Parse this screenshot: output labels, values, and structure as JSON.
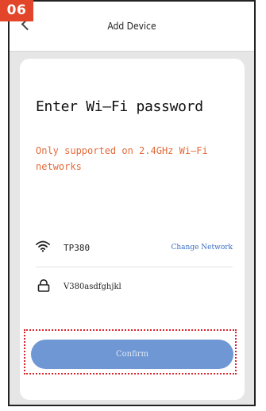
{
  "step_badge": "06",
  "header": {
    "title": "Add Device"
  },
  "card": {
    "heading": "Enter Wi—Fi password",
    "note": "Only supported on 2.4GHz Wi—Fi networks"
  },
  "wifi_row": {
    "icon": "wifi-icon",
    "ssid": "TP380",
    "change_label": "Change Network"
  },
  "password_row": {
    "icon": "lock-icon",
    "value": "V380asdfghjkl"
  },
  "confirm_button": {
    "label": "Confirm"
  },
  "colors": {
    "badge": "#e3452a",
    "note_text": "#e36a3a",
    "link": "#3a6ec5",
    "button": "#6f97d3",
    "highlight_outline": "#d9262d",
    "page_background": "#e6e6e6"
  }
}
